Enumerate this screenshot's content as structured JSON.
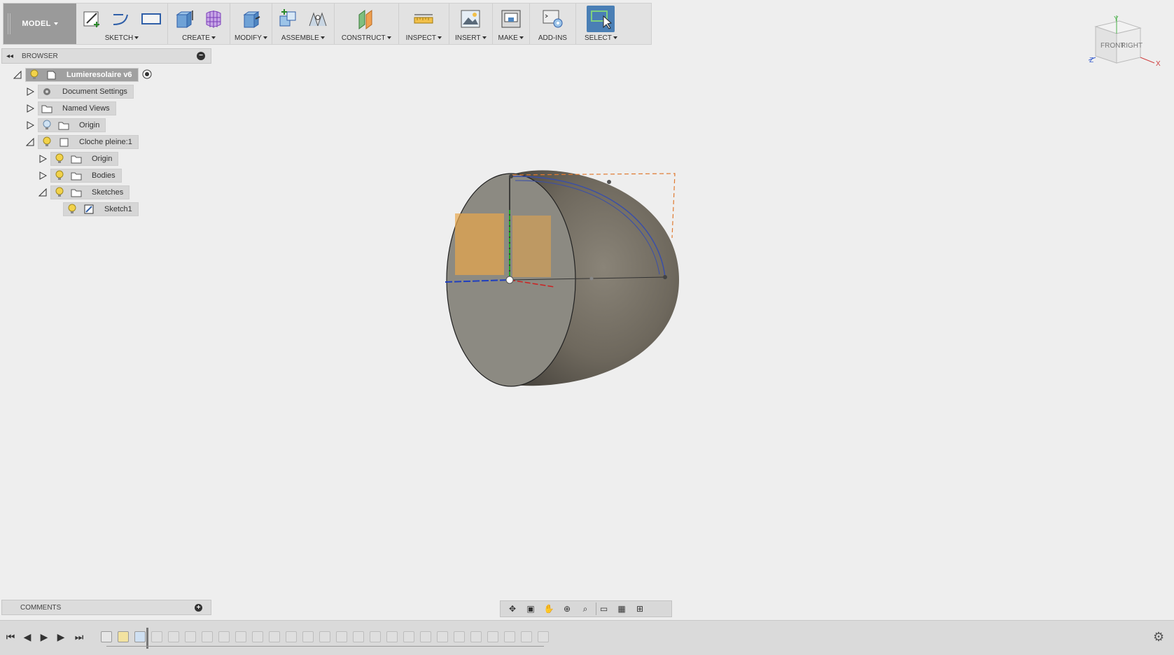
{
  "toolbar": {
    "model_label": "MODEL",
    "groups": [
      {
        "label": "SKETCH"
      },
      {
        "label": "CREATE"
      },
      {
        "label": "MODIFY"
      },
      {
        "label": "ASSEMBLE"
      },
      {
        "label": "CONSTRUCT"
      },
      {
        "label": "INSPECT"
      },
      {
        "label": "INSERT"
      },
      {
        "label": "MAKE"
      },
      {
        "label": "ADD-INS"
      },
      {
        "label": "SELECT"
      }
    ]
  },
  "browser": {
    "title": "BROWSER",
    "root": "Lumieresolaire v6",
    "items": [
      {
        "label": "Document Settings"
      },
      {
        "label": "Named Views"
      },
      {
        "label": "Origin"
      },
      {
        "label": "Cloche pleine:1"
      },
      {
        "label": "Origin"
      },
      {
        "label": "Bodies"
      },
      {
        "label": "Sketches"
      },
      {
        "label": "Sketch1"
      }
    ]
  },
  "comments": {
    "title": "COMMENTS"
  },
  "viewcube": {
    "front": "FRONT",
    "right": "RIGHT",
    "axis_x": "X",
    "axis_y": "Y",
    "axis_z": "Z"
  },
  "colors": {
    "toolbar_bg": "#e2e2e2",
    "model_btn": "#9a9a9a",
    "select_active": "#4a7fb5",
    "body_face": "#8c8a82",
    "sketch_profile": "#e8a64a"
  }
}
